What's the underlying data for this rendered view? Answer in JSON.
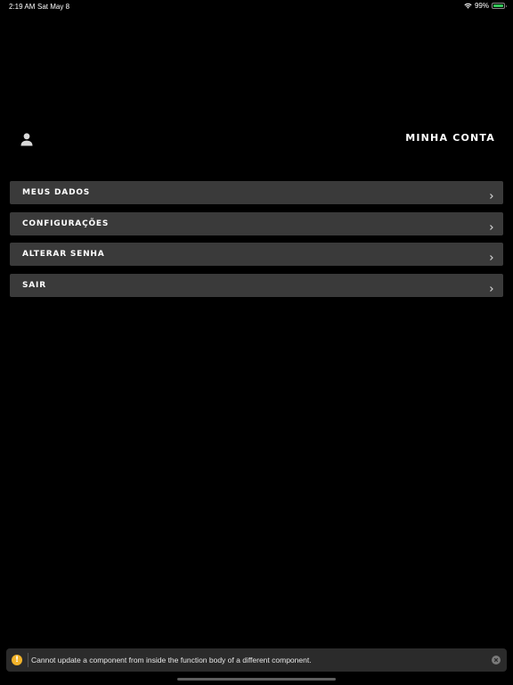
{
  "status_bar": {
    "time": "2:19 AM",
    "date": "Sat May 8",
    "battery": "99%",
    "battery_level": 0.99,
    "wifi_icon": "wifi-icon",
    "battery_icon": "battery-icon"
  },
  "header": {
    "title": "Minha Conta",
    "user_icon": "user-icon"
  },
  "menu": {
    "items": [
      {
        "label": "Meus Dados",
        "icon": "chevron-right-icon"
      },
      {
        "label": "Configurações",
        "icon": "chevron-right-icon"
      },
      {
        "label": "Alterar Senha",
        "icon": "chevron-right-icon"
      },
      {
        "label": "Sair",
        "icon": "chevron-right-icon"
      }
    ]
  },
  "toast": {
    "icon": "warning-icon",
    "icon_glyph": "!",
    "message": "Cannot update a component from inside the function body of a different component.",
    "close_icon": "close-icon"
  },
  "colors": {
    "background": "#000000",
    "menu_item": "#3a3a3a",
    "warning": "#f2b32a",
    "battery": "#34c759"
  }
}
